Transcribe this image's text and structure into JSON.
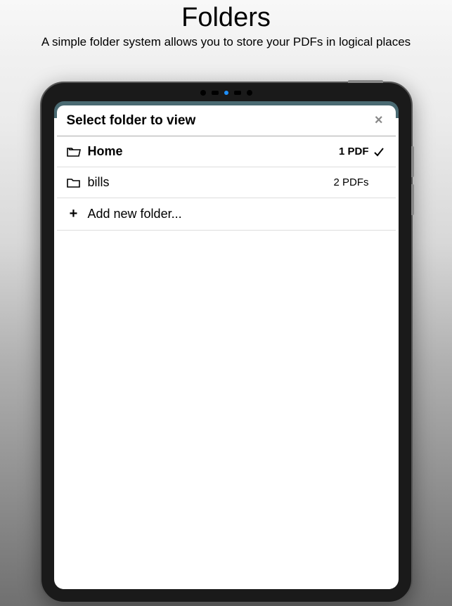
{
  "page": {
    "title": "Folders",
    "subtitle": "A simple folder system allows you to store your PDFs in logical places"
  },
  "modal": {
    "title": "Select folder to view",
    "close": "×"
  },
  "folders": [
    {
      "name": "Home",
      "count_label": "1 PDF",
      "selected": true
    },
    {
      "name": "bills",
      "count_label": "2 PDFs",
      "selected": false
    }
  ],
  "add_label": "Add new folder..."
}
